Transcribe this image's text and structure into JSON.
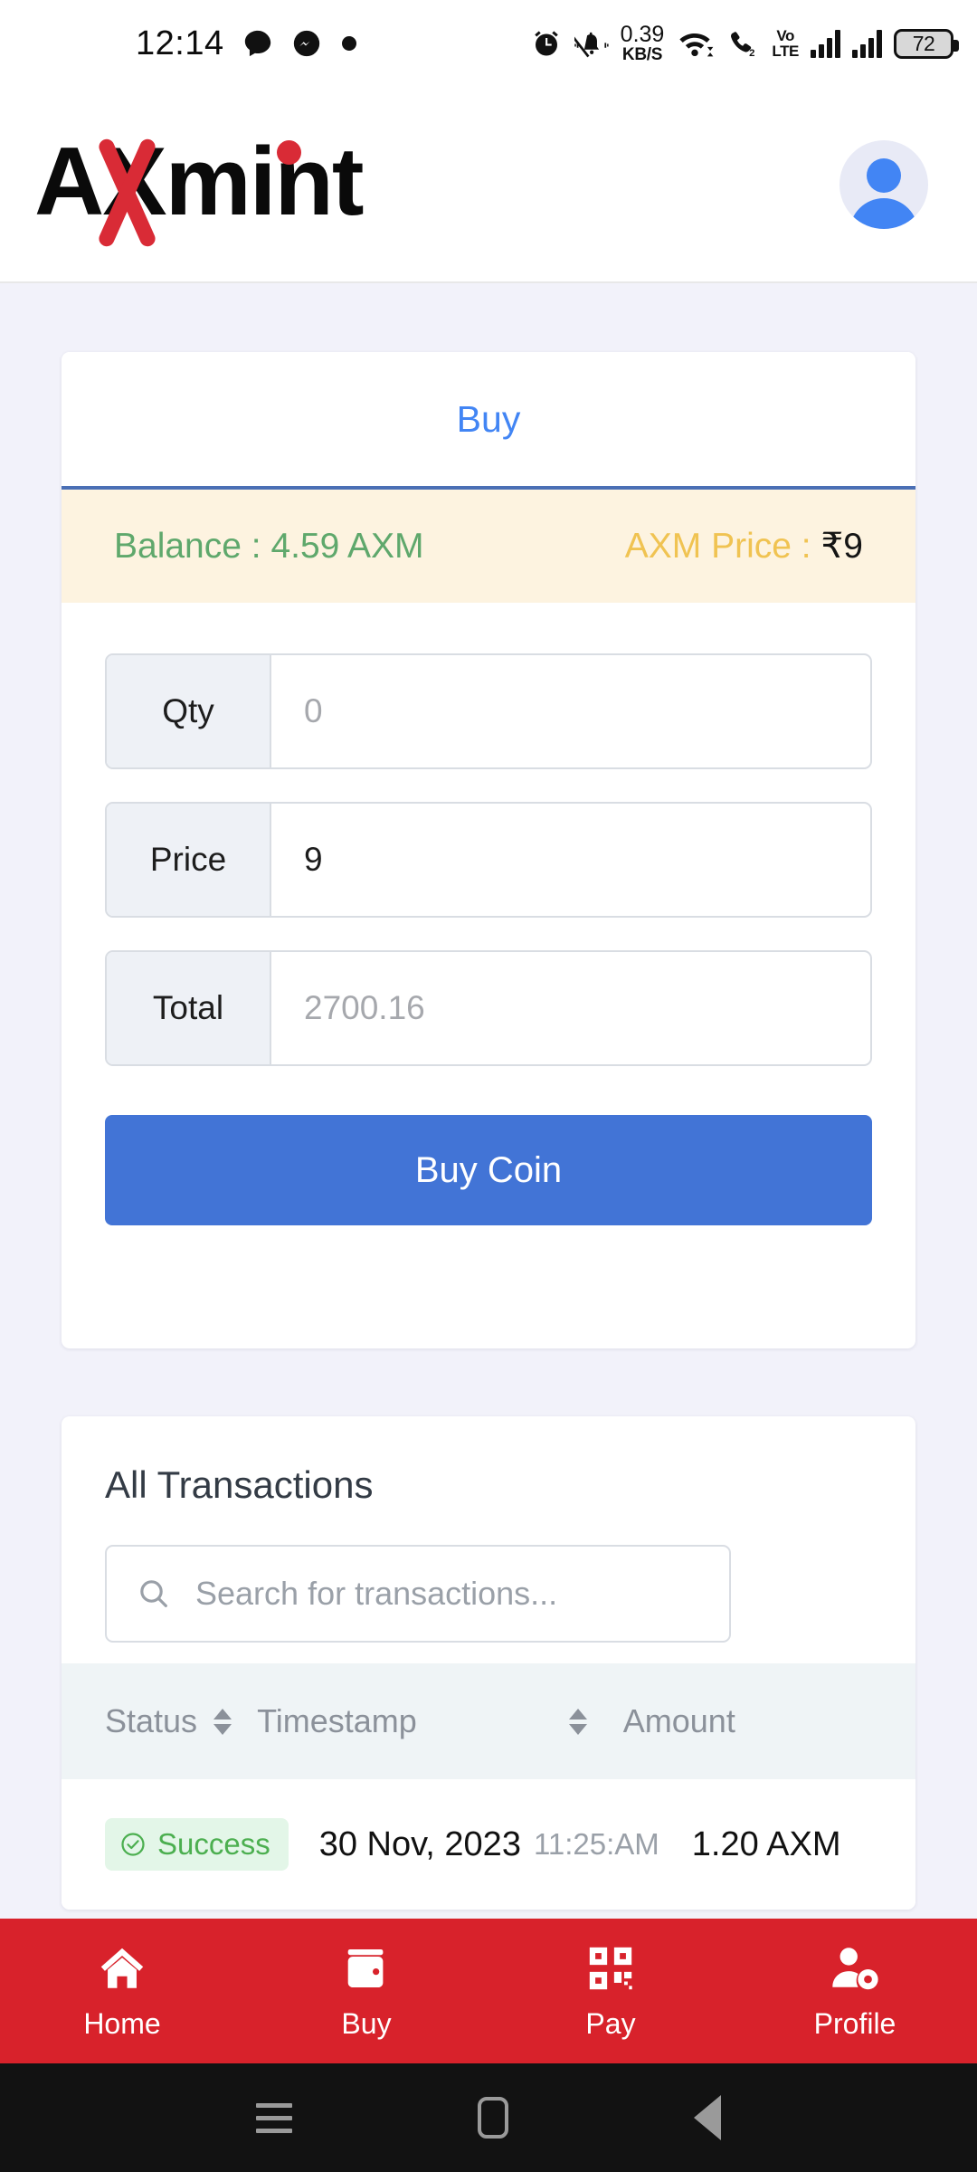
{
  "status_bar": {
    "clock": "12:14",
    "network_speed_value": "0.39",
    "network_speed_unit": "KB/S",
    "volte_line1": "Vo",
    "volte_line2": "LTE",
    "battery_percent": "72",
    "icons": [
      "chat-bubble-icon",
      "messenger-icon",
      "dot-icon",
      "alarm-icon",
      "mute-bell-icon",
      "wifi-icon",
      "call-icon",
      "volte-icon",
      "signal-bars-icon",
      "signal-bars-icon",
      "battery-icon"
    ]
  },
  "header": {
    "logo_text_a": "A",
    "logo_text_mint": "mint",
    "logo_full": "AXmint",
    "avatar_icon": "user-avatar-icon"
  },
  "buy_card": {
    "tab_label": "Buy",
    "balance_label": "Balance : 4.59 AXM",
    "price_label": "AXM Price : ",
    "price_value": "₹9",
    "fields": [
      {
        "label": "Qty",
        "value": "0",
        "is_placeholder": true
      },
      {
        "label": "Price",
        "value": "9",
        "is_placeholder": false
      },
      {
        "label": "Total",
        "value": "2700.16",
        "is_placeholder": true
      }
    ],
    "submit_label": "Buy Coin"
  },
  "transactions": {
    "title": "All Transactions",
    "search_placeholder": "Search for transactions...",
    "columns": [
      "Status",
      "Timestamp",
      "Amount"
    ],
    "rows": [
      {
        "status": "Success",
        "date": "30 Nov, 2023",
        "time": "11:25:AM",
        "amount": "1.20 AXM"
      }
    ]
  },
  "bottom_nav": {
    "items": [
      {
        "label": "Home",
        "icon": "home-icon"
      },
      {
        "label": "Buy",
        "icon": "wallet-icon"
      },
      {
        "label": "Pay",
        "icon": "qr-code-icon"
      },
      {
        "label": "Profile",
        "icon": "user-settings-icon"
      }
    ]
  },
  "system_nav": {
    "recents": "recents-icon",
    "home": "home-pill-icon",
    "back": "back-triangle-icon"
  },
  "colors": {
    "brand_red": "#d8222b",
    "accent_blue": "#4274d6",
    "tab_blue": "#4285f4",
    "balance_green": "#5fa86c",
    "price_yellow": "#f0c352",
    "balance_bg": "#fdf3e0",
    "page_bg": "#f2f2fa",
    "success_green": "#4caf50"
  }
}
